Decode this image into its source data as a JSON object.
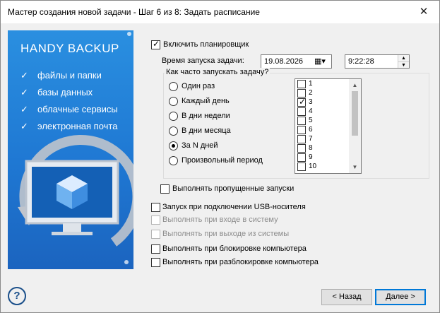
{
  "window": {
    "title": "Мастер создания новой задачи - Шаг 6 из 8: Задать расписание",
    "close_glyph": "✕"
  },
  "promo": {
    "logo": "HANDY BACKUP",
    "features": [
      "файлы и папки",
      "базы данных",
      "облачные сервисы",
      "электронная почта"
    ]
  },
  "scheduler": {
    "enable_label": "Включить планировщик",
    "enable_checked": true,
    "start_time_label": "Время запуска задачи:",
    "date": "19.08.2026",
    "time": "9:22:28"
  },
  "frequency": {
    "title": "Как часто запускать задачу?",
    "options": [
      "Один раз",
      "Каждый день",
      "В дни недели",
      "В дни месяца",
      "За N дней",
      "Произвольный период"
    ],
    "selected": "За N дней",
    "days_list": [
      "1",
      "2",
      "3",
      "4",
      "5",
      "6",
      "7",
      "8",
      "9",
      "10"
    ],
    "days_checked": [
      "3"
    ]
  },
  "options": {
    "missed_label": "Выполнять пропущенные запуски",
    "usb_label": "Запуск при подключении USB-носителя",
    "login_label": "Выполнять при входе в систему",
    "logout_label": "Выполнять при выходе из системы",
    "lock_label": "Выполнять при блокировке компьютера",
    "unlock_label": "Выполнять при разблокировке компьютера"
  },
  "buttons": {
    "back": "< Назад",
    "next": "Далее >",
    "help": "?"
  },
  "colors": {
    "promo_blue": "#1f78d3",
    "accent": "#0078d7"
  }
}
